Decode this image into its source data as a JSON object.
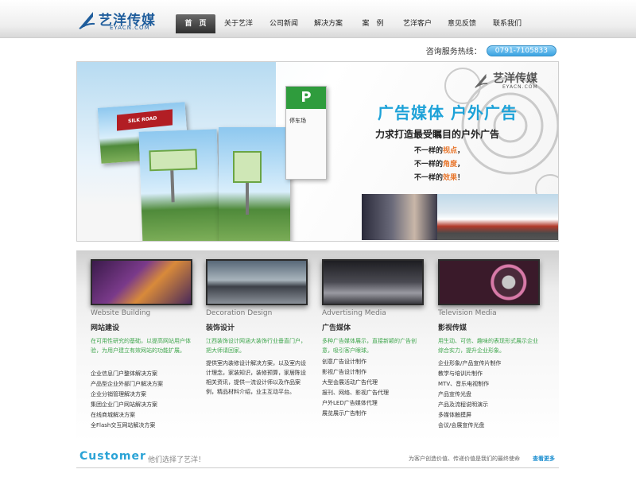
{
  "logo": {
    "name_cn": "艺洋传媒",
    "name_en": "EYACN.COM"
  },
  "nav": {
    "items": [
      {
        "label": "首　页",
        "active": true
      },
      {
        "label": "关于艺洋"
      },
      {
        "label": "公司新闻"
      },
      {
        "label": "解决方案"
      },
      {
        "label": "案　例"
      },
      {
        "label": "艺洋客户"
      },
      {
        "label": "意见反馈"
      },
      {
        "label": "联系我们"
      }
    ]
  },
  "hotline": {
    "label": "咨询服务热线：",
    "number": "0791-7105833"
  },
  "banner": {
    "logo_cn": "艺洋传媒",
    "logo_en": "EYACN.COM",
    "title": "广告媒体  户外广告",
    "subtitle": "力求打造最受瞩目的户外广告",
    "lines": [
      {
        "pre": "不一样的",
        "hl": "视点",
        "post": "，"
      },
      {
        "pre": "不一样的",
        "hl": "角度",
        "post": "，"
      },
      {
        "pre": "不一样的",
        "hl": "效果",
        "post": "！"
      }
    ],
    "billboard_text": "SILK ROAD",
    "sign_letter": "P",
    "sign_text": "停车场"
  },
  "services": [
    {
      "en": "Website Building",
      "cn": "网站建设",
      "desc": "在可用性研究的基础，以提高网站用户体验，为用户建立有效网站的功能扩展。",
      "items": [
        "企业信息门户整体解决方案",
        "产品型企业外部门户解决方案",
        "企业分销管理解决方案",
        "集团企业门户网站解决方案",
        "在线商城解决方案",
        "全Flash交互网站解决方案"
      ]
    },
    {
      "en": "Decoration Design",
      "cn": "装饰设计",
      "desc": "江西装饰设计网涵大装饰行业垂直门户，把大师请回家。",
      "text": "提供室内装修设计解决方案，以及室内设计理念，家装知识，装修预算，家居陈设相关资讯，提供一流设计师以及作品案例，精品材料介绍，业主互动平台。"
    },
    {
      "en": "Advertising Media",
      "cn": "广告媒体",
      "desc": "多种广告媒体展示，直接新颖的广告创意，吸引客户眼球。",
      "items": [
        "创意广告设计制作",
        "影视广告设计制作",
        "大型会展活动广告代理",
        "报刊、网络、影视广告代理",
        "户外LED广告媒体代理",
        "展览展示广告制作"
      ]
    },
    {
      "en": "Television Media",
      "cn": "影视传媒",
      "desc": "用生动、可信、趣味的表现形式展示企业综合实力，提升企业形象。",
      "items": [
        "企业形象/产品宣传片制作",
        "教学与培训片制作",
        "MTV、音乐电视制作",
        "产品宣传光盘",
        "产品及流程说明演示",
        "多媒体触摸屏",
        "会议/会展宣传光盘"
      ]
    }
  ],
  "customer": {
    "title": "Customer",
    "subtitle": "他们选择了艺洋！",
    "slogan": "为客户创造价值、传递价值是我们的最终使命",
    "more": "查看更多"
  }
}
